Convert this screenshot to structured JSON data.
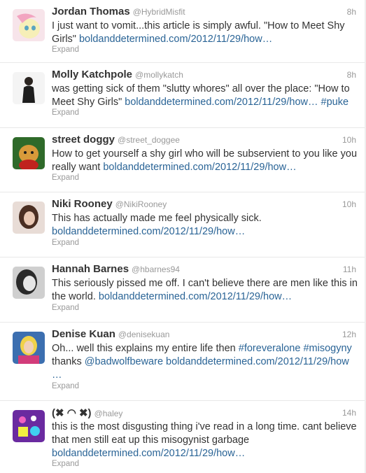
{
  "expand_label": "Expand",
  "colors": {
    "link": "#2a6496",
    "meta": "#999999",
    "text": "#333333"
  },
  "tweets": [
    {
      "name": "Jordan Thomas",
      "handle": "@HybridMisfit",
      "time": "8h",
      "avatar": "pony-avatar-icon",
      "line1": "I just want to vomit...this article is simply awful. \"How to Meet Shy",
      "line2_text": "Girls\" ",
      "line2_link": "boldanddetermined.com/2012/11/29/how…"
    },
    {
      "name": "Molly Katchpole",
      "handle": "@mollykatch",
      "time": "8h",
      "avatar": "person-avatar-icon",
      "line1": "was getting sick of them \"slutty whores\" all over the place: \"How to",
      "line2_text": "Meet Shy Girls\" ",
      "line2_link": "boldanddetermined.com/2012/11/29/how…",
      "line2_tag": " #puke"
    },
    {
      "name": "street doggy",
      "handle": "@street_doggee",
      "time": "10h",
      "avatar": "dog-avatar-icon",
      "line1": "How to get yourself a shy girl who will be subservient to you like you",
      "line2_text": "really want ",
      "line2_link": "boldanddetermined.com/2012/11/29/how…"
    },
    {
      "name": "Niki Rooney",
      "handle": "@NikiRooney",
      "time": "10h",
      "avatar": "person-avatar-icon",
      "line1": "This has actually made me feel physically sick.",
      "line2_link": "boldanddetermined.com/2012/11/29/how…"
    },
    {
      "name": "Hannah Barnes",
      "handle": "@hbarnes94",
      "time": "11h",
      "avatar": "person-avatar-icon",
      "line1": "This seriously pissed me off. I can't believe there are men like this in",
      "line2_text": "the world. ",
      "line2_link": "boldanddetermined.com/2012/11/29/how…"
    },
    {
      "name": "Denise Kuan",
      "handle": "@denisekuan",
      "time": "12h",
      "avatar": "person-avatar-icon",
      "line1_text": "Oh... well this explains my entire life then ",
      "line1_tag1": "#foreveralone",
      "line1_tag2": " #misogyny",
      "line2_text": "thanks ",
      "line2_mention": "@badwolfbeware",
      "line2_link": " boldanddetermined.com/2012/11/29/how",
      "line3_link": "…"
    },
    {
      "name": "(✖ ◠ ✖)",
      "handle": "@haley",
      "time": "14h",
      "avatar": "cartoon-avatar-icon",
      "line1": "this is the most disgusting thing i've read in a long time. cant believe",
      "line2_text": "that men still eat up this misogynist garbage",
      "line3_link": "boldanddetermined.com/2012/11/29/how…"
    }
  ]
}
